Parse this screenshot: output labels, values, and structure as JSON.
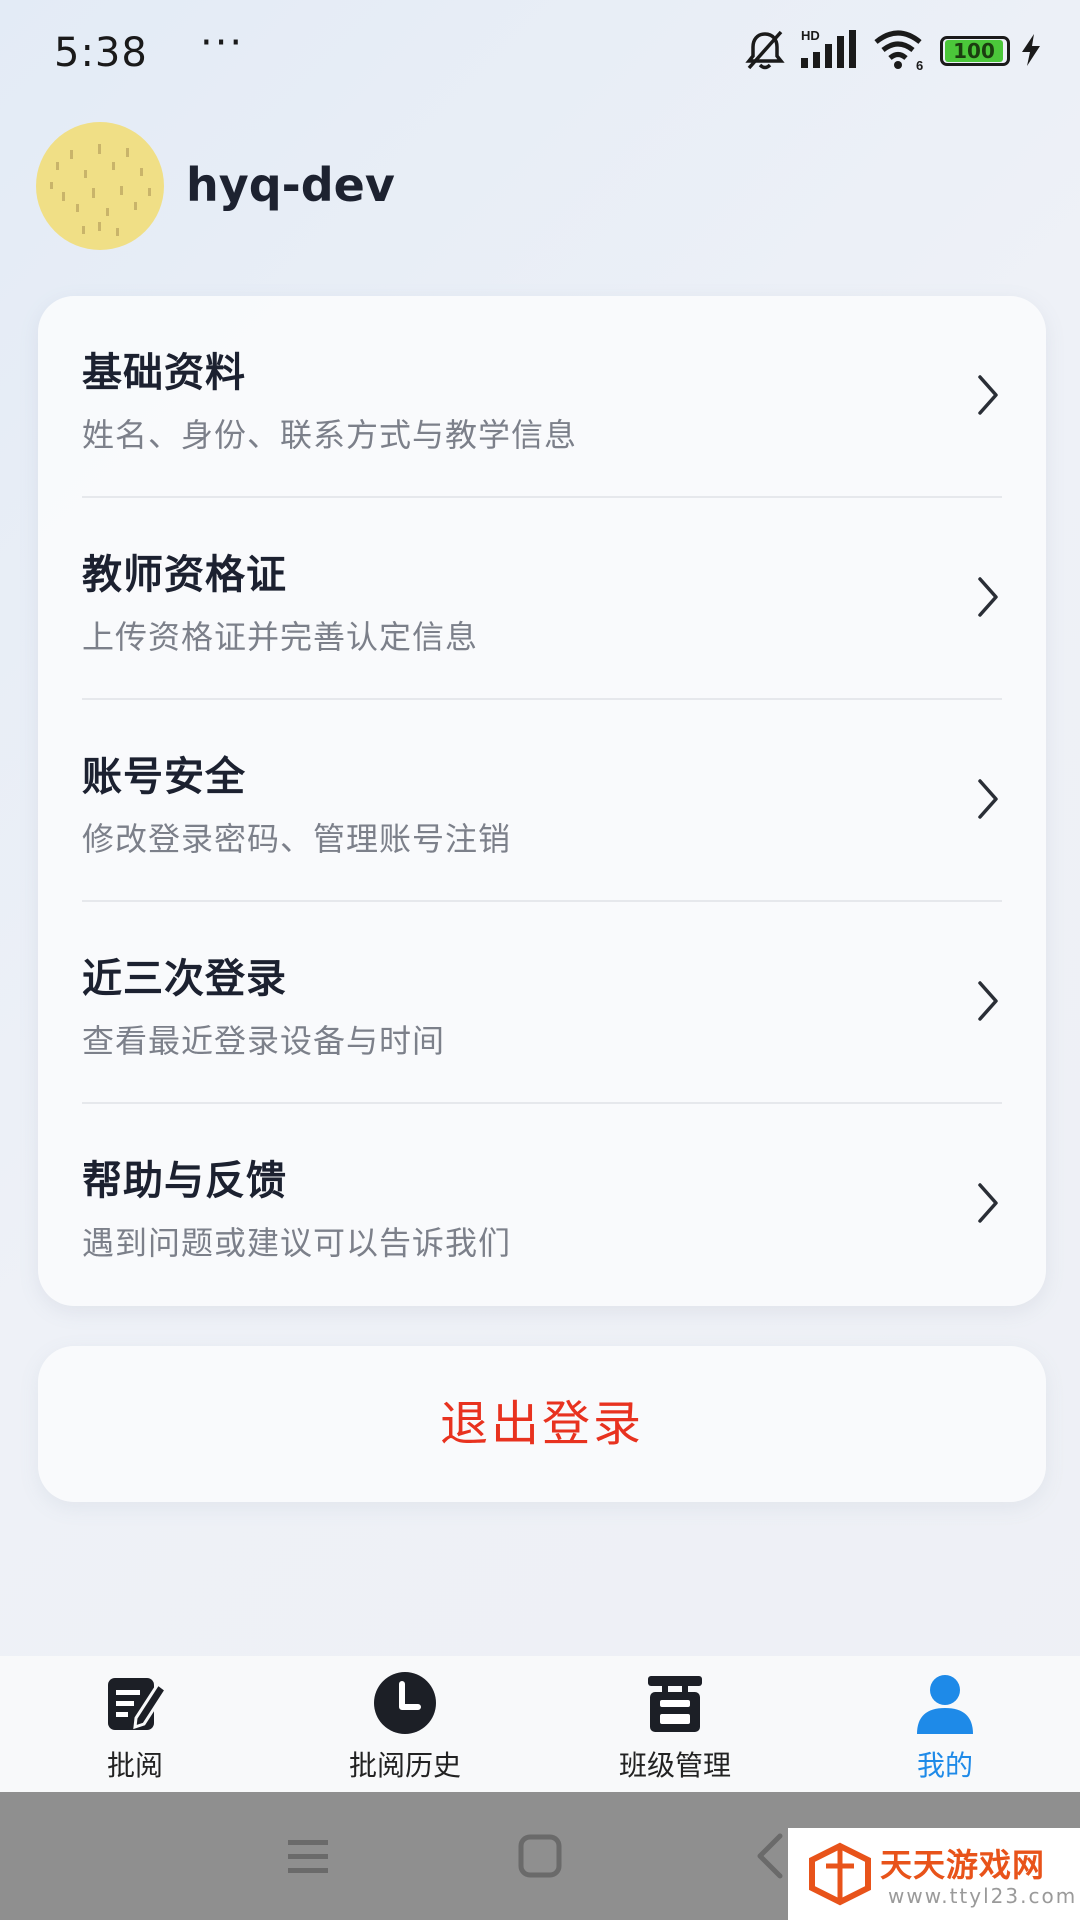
{
  "status_bar": {
    "time": "5:38",
    "more": "···",
    "network_badge": "HD",
    "wifi_badge": "6",
    "battery_level": "100",
    "icons": [
      "silent-bell-icon",
      "cellular-signal-icon",
      "wifi-icon",
      "battery-icon",
      "charging-bolt-icon"
    ]
  },
  "profile": {
    "username": "hyq-dev",
    "avatar_color": "#f0df86"
  },
  "menu": {
    "items": [
      {
        "title": "基础资料",
        "subtitle": "姓名、身份、联系方式与教学信息"
      },
      {
        "title": "教师资格证",
        "subtitle": "上传资格证并完善认定信息"
      },
      {
        "title": "账号安全",
        "subtitle": "修改登录密码、管理账号注销"
      },
      {
        "title": "近三次登录",
        "subtitle": "查看最近登录设备与时间"
      },
      {
        "title": "帮助与反馈",
        "subtitle": "遇到问题或建议可以告诉我们"
      }
    ]
  },
  "logout": {
    "label": "退出登录",
    "color": "#e8321f"
  },
  "tabs": [
    {
      "label": "批阅",
      "icon": "edit-document-icon"
    },
    {
      "label": "批阅历史",
      "icon": "clock-icon"
    },
    {
      "label": "班级管理",
      "icon": "class-box-icon"
    },
    {
      "label": "我的",
      "icon": "user-icon",
      "active": true
    }
  ],
  "active_color": "#1e8ae8",
  "system_nav": [
    "menu-icon",
    "home-icon",
    "back-icon"
  ],
  "watermark": {
    "title": "天天游戏网",
    "url": "www.ttyl23.com"
  }
}
